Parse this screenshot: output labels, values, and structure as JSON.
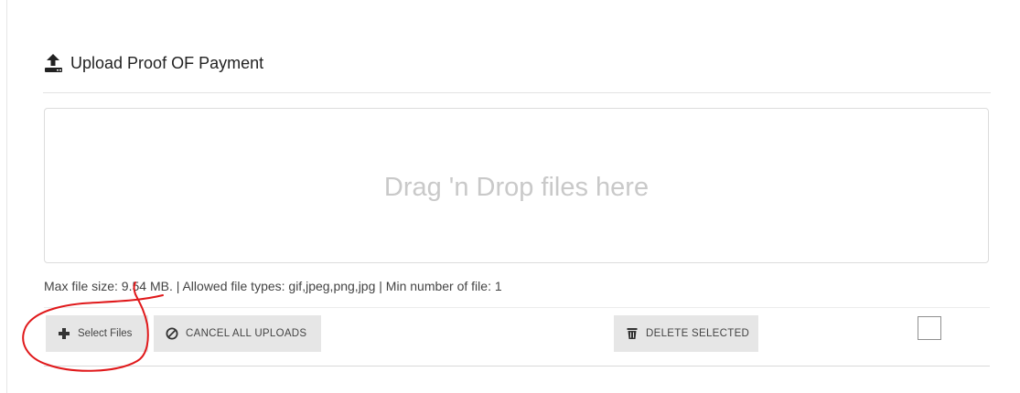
{
  "header": {
    "title": "Upload Proof OF Payment",
    "icon": "upload-icon"
  },
  "dropzone": {
    "text": "Drag 'n Drop files here"
  },
  "file_info": "Max file size: 9.54 MB. | Allowed file types: gif,jpeg,png,jpg | Min number of file: 1",
  "toolbar": {
    "select_files_label": "Select Files",
    "select_files_icon": "plus-icon",
    "cancel_all_label": "CANCEL ALL UPLOADS",
    "cancel_all_icon": "ban-icon",
    "delete_selected_label": "DELETE SELECTED",
    "delete_selected_icon": "trash-icon",
    "select_all_checked": false
  },
  "annotation": {
    "color": "#e0191b",
    "shape": "hand-drawn circle around Select Files"
  },
  "colors": {
    "button_bg": "#e6e6e6",
    "dropzone_text": "#c9c9c9",
    "text": "#444444"
  }
}
